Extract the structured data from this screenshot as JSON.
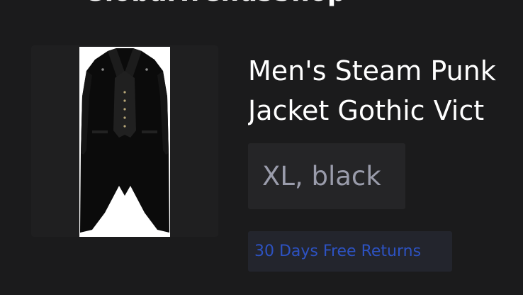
{
  "header": {
    "store_name": "GlobalTrendsShop",
    "menu_icon": "hamburger-menu-icon"
  },
  "product": {
    "title_line1": "Men's Steam Punk",
    "title_line2": "Jacket Gothic Vict",
    "image_alt": "Black tailcoat jacket",
    "variant": "XL, black",
    "returns_badge": "30 Days Free Returns"
  },
  "colors": {
    "background": "#1b1b1c",
    "variant_chip_background": "#252527",
    "variant_text": "#9a9cab",
    "badge_background": "#23252d",
    "badge_text": "#2d52c2"
  }
}
